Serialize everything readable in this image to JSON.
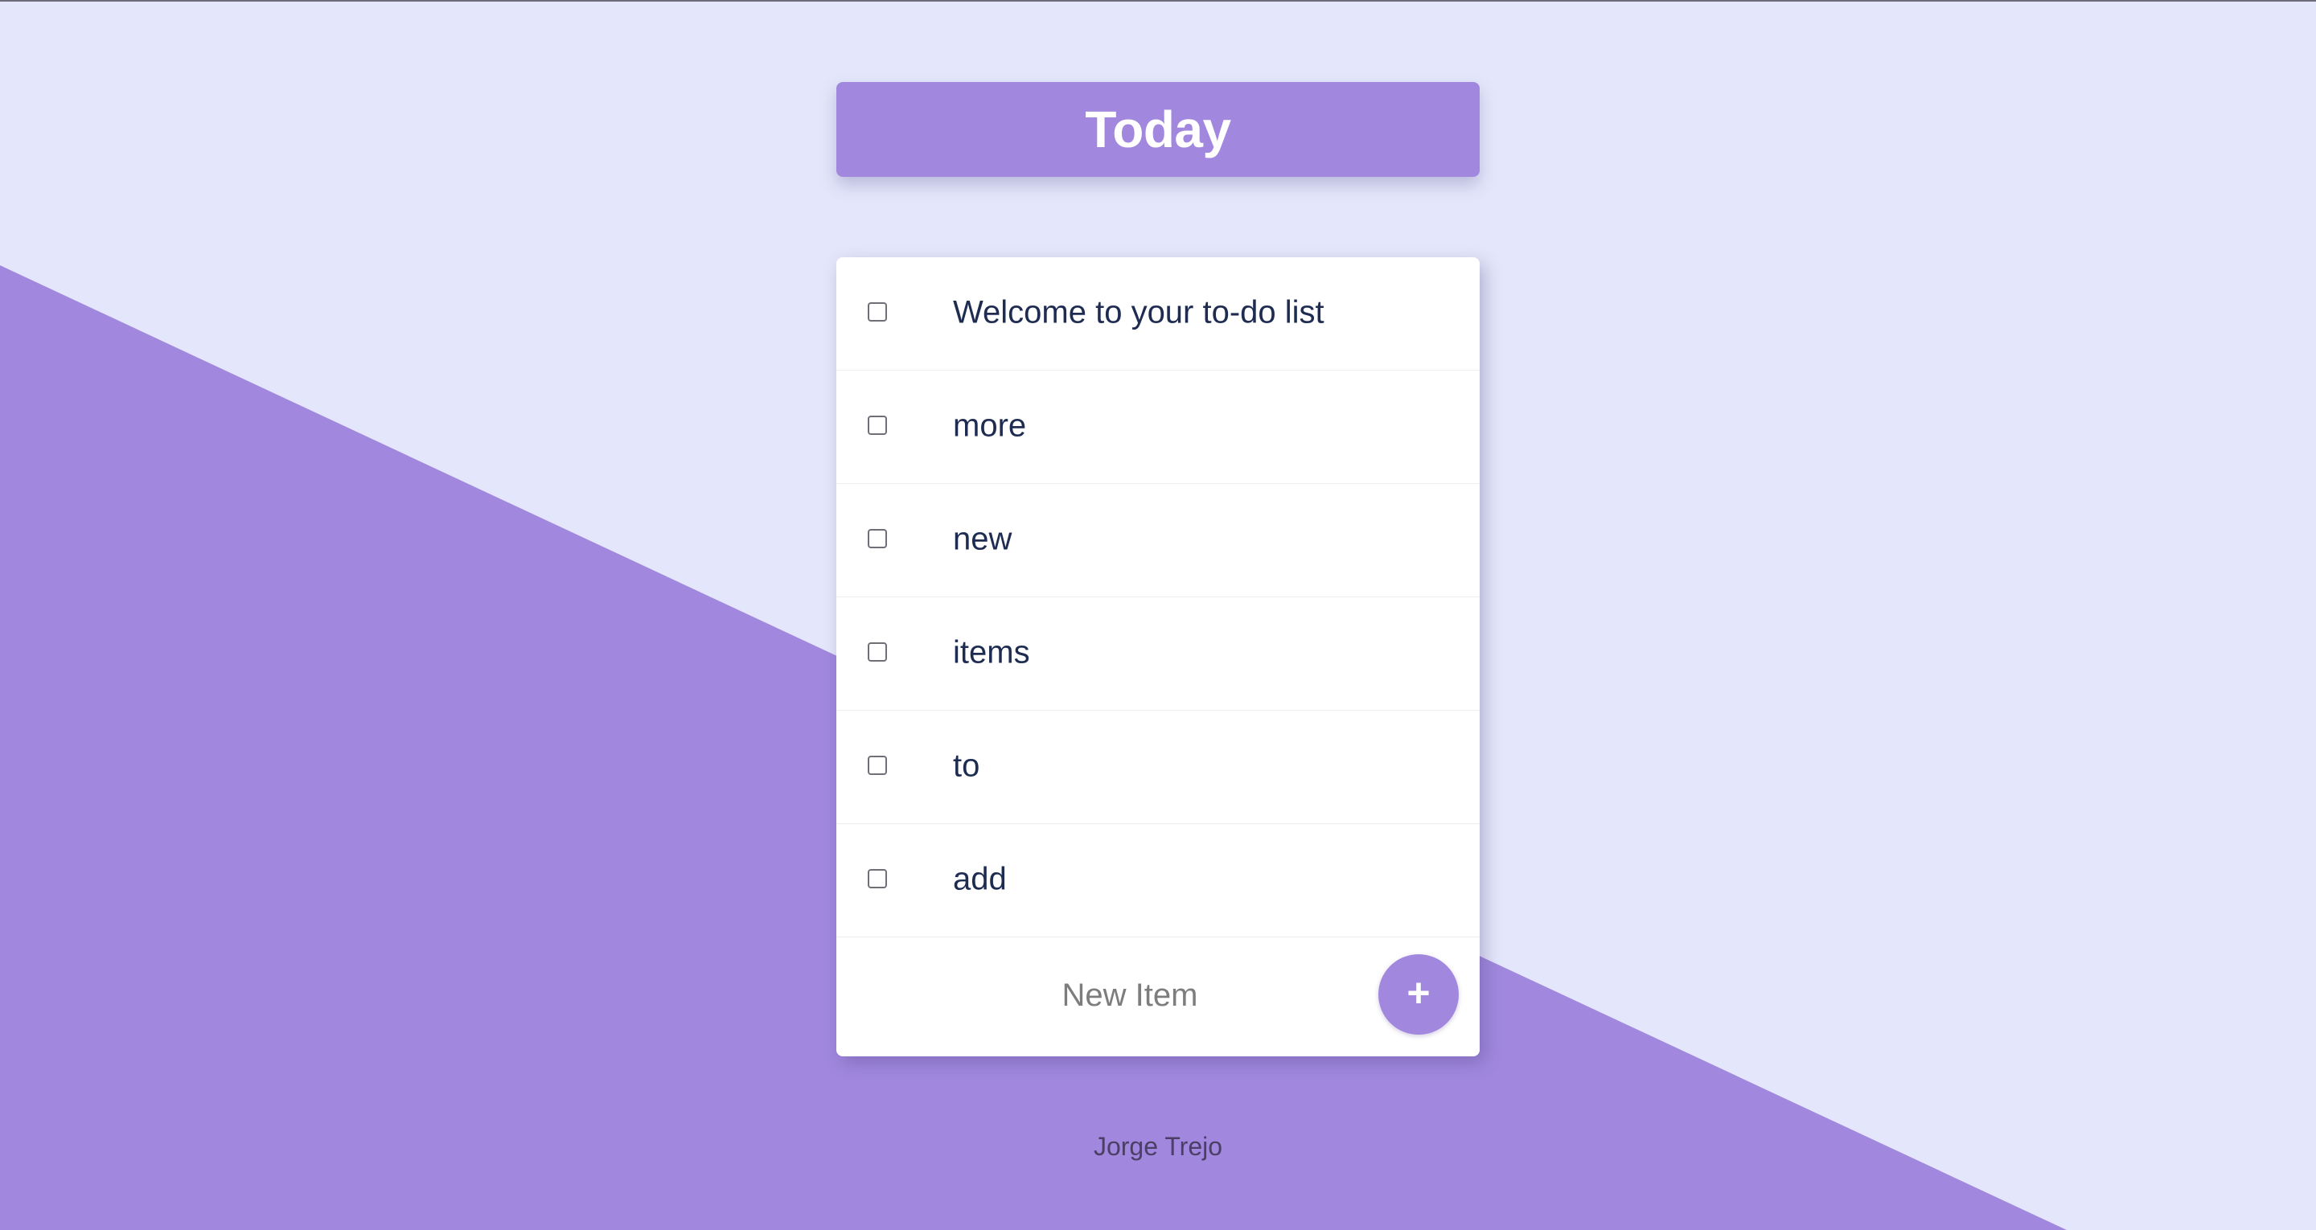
{
  "colors": {
    "background": "#e4e7fb",
    "accent": "#a188de",
    "card": "#ffffff",
    "item_text": "#1f2c52",
    "footer_text": "#4b3f66"
  },
  "header": {
    "title": "Today"
  },
  "todo": {
    "items": [
      {
        "label": "Welcome to your to-do list",
        "checked": false
      },
      {
        "label": "more",
        "checked": false
      },
      {
        "label": "new",
        "checked": false
      },
      {
        "label": "items",
        "checked": false
      },
      {
        "label": "to",
        "checked": false
      },
      {
        "label": "add",
        "checked": false
      }
    ],
    "new_item_placeholder": "New Item",
    "new_item_value": "",
    "add_button_label": "+",
    "add_button_icon": "plus-icon"
  },
  "footer": {
    "text": "Jorge Trejo"
  }
}
